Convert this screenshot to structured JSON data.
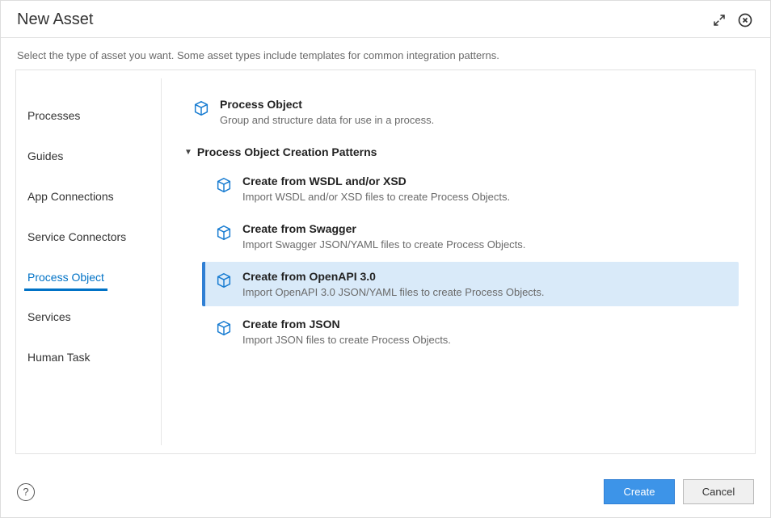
{
  "header": {
    "title": "New Asset"
  },
  "subtext": "Select the type of asset you want. Some asset types include templates for common integration patterns.",
  "sidebar": {
    "items": [
      {
        "label": "Processes",
        "selected": false
      },
      {
        "label": "Guides",
        "selected": false
      },
      {
        "label": "App Connections",
        "selected": false
      },
      {
        "label": "Service Connectors",
        "selected": false
      },
      {
        "label": "Process Object",
        "selected": true
      },
      {
        "label": "Services",
        "selected": false
      },
      {
        "label": "Human Task",
        "selected": false
      }
    ]
  },
  "main": {
    "primary_option": {
      "title": "Process Object",
      "desc": "Group and structure data for use in a process."
    },
    "section_label": "Process Object Creation Patterns",
    "options": [
      {
        "title": "Create from WSDL and/or XSD",
        "desc": "Import WSDL and/or XSD files to create Process Objects.",
        "selected": false
      },
      {
        "title": "Create from Swagger",
        "desc": "Import Swagger JSON/YAML files to create Process Objects.",
        "selected": false
      },
      {
        "title": "Create from OpenAPI 3.0",
        "desc": "Import OpenAPI 3.0 JSON/YAML files to create Process Objects.",
        "selected": true
      },
      {
        "title": "Create from JSON",
        "desc": "Import JSON files to create Process Objects.",
        "selected": false
      }
    ]
  },
  "footer": {
    "help": "?",
    "create": "Create",
    "cancel": "Cancel"
  }
}
